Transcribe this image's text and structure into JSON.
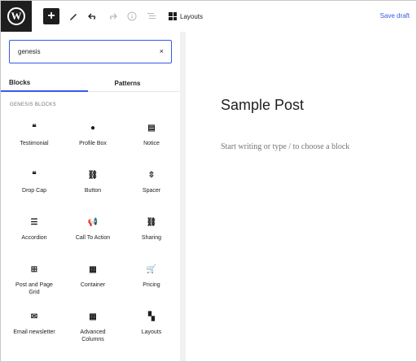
{
  "toolbar": {
    "logo": "W",
    "add": "+",
    "layouts_label": "Layouts",
    "save_draft": "Save draft"
  },
  "sidebar": {
    "search_value": "genesis",
    "clear": "×",
    "tabs": [
      "Blocks",
      "Patterns"
    ],
    "section_title": "GENESIS BLOCKS",
    "blocks": [
      {
        "label": "Testimonial",
        "icon": "quote-icon",
        "glyph": "❝"
      },
      {
        "label": "Profile Box",
        "icon": "person-icon",
        "glyph": "●"
      },
      {
        "label": "Notice",
        "icon": "notice-icon",
        "glyph": "▤"
      },
      {
        "label": "Drop Cap",
        "icon": "quote-icon",
        "glyph": "❝"
      },
      {
        "label": "Button",
        "icon": "link-icon",
        "glyph": "⛓"
      },
      {
        "label": "Spacer",
        "icon": "spacer-icon",
        "glyph": "⇳"
      },
      {
        "label": "Accordion",
        "icon": "list-icon",
        "glyph": "☰"
      },
      {
        "label": "Call To Action",
        "icon": "megaphone-icon",
        "glyph": "📢"
      },
      {
        "label": "Sharing",
        "icon": "link-icon",
        "glyph": "⛓"
      },
      {
        "label": "Post and Page Grid",
        "icon": "grid-icon",
        "glyph": "⊞"
      },
      {
        "label": "Container",
        "icon": "container-icon",
        "glyph": "▦"
      },
      {
        "label": "Pricing",
        "icon": "cart-icon",
        "glyph": "🛒"
      },
      {
        "label": "Email newsletter",
        "icon": "email-icon",
        "glyph": "✉"
      },
      {
        "label": "Advanced Columns",
        "icon": "columns-icon",
        "glyph": "▦"
      },
      {
        "label": "Layouts",
        "icon": "layouts-icon",
        "glyph": "▚"
      }
    ]
  },
  "editor": {
    "title": "Sample Post",
    "placeholder": "Start writing or type / to choose a block"
  }
}
